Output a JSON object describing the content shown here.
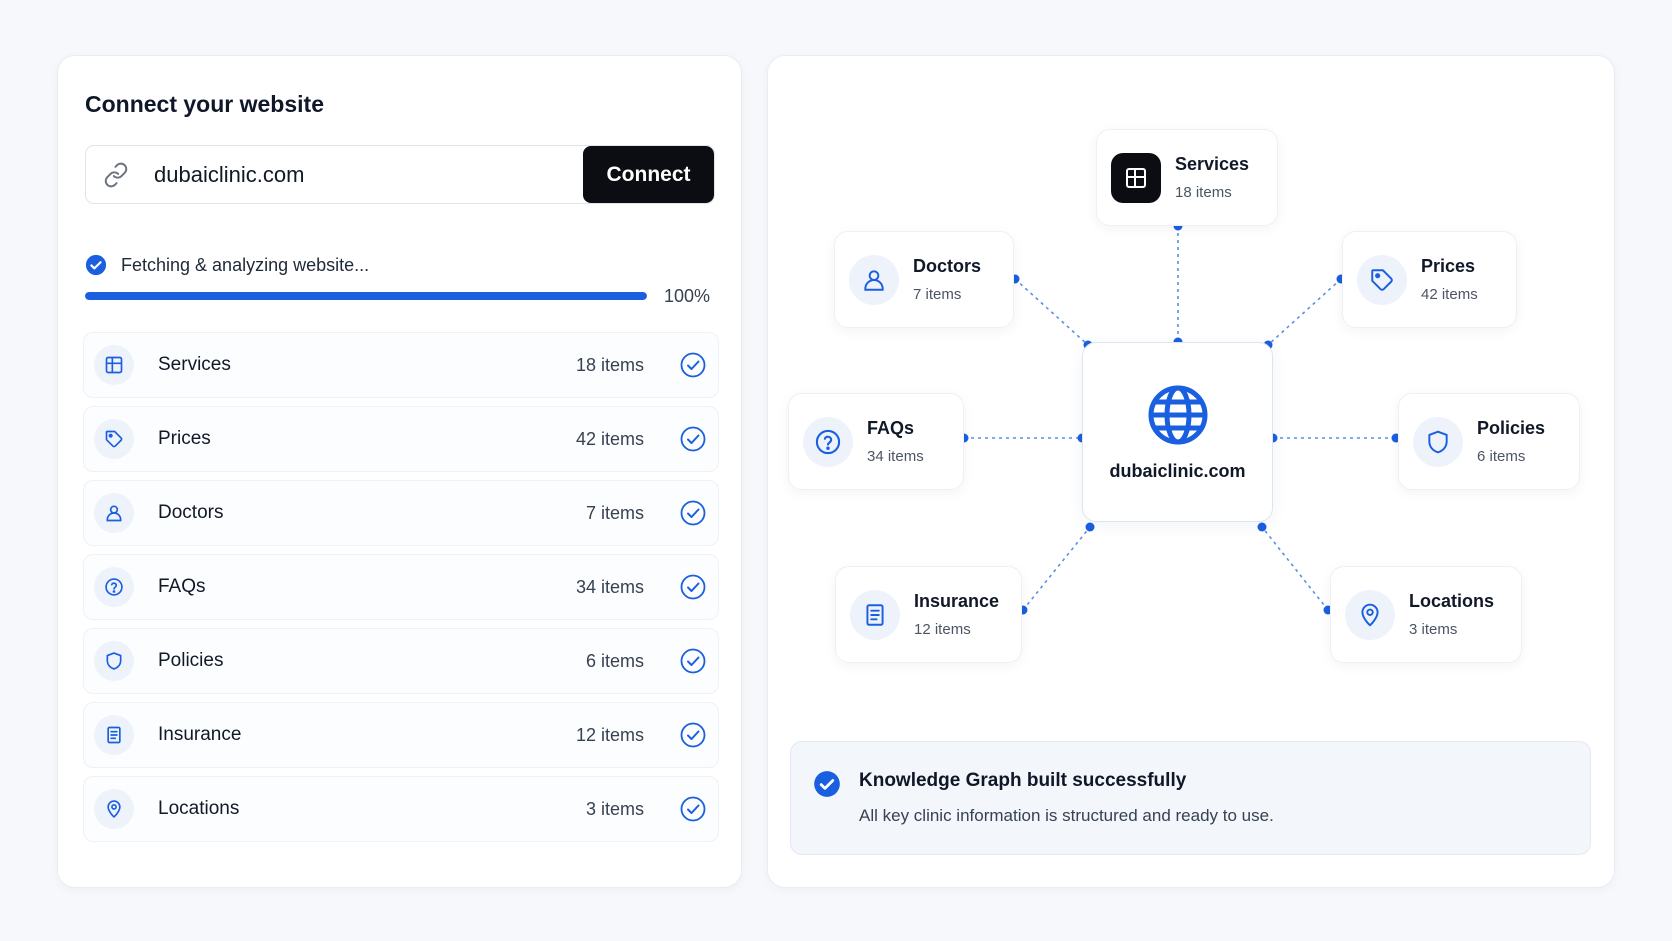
{
  "left_panel": {
    "title": "Connect your website",
    "url_value": "dubaiclinic.com",
    "connect_label": "Connect",
    "status_text": "Fetching & analyzing website...",
    "progress": 100,
    "progress_label": "100%",
    "items": [
      {
        "icon": "grid-icon",
        "label": "Services",
        "count": "18 items"
      },
      {
        "icon": "tag-icon",
        "label": "Prices",
        "count": "42 items"
      },
      {
        "icon": "user-icon",
        "label": "Doctors",
        "count": "7 items"
      },
      {
        "icon": "question-icon",
        "label": "FAQs",
        "count": "34 items"
      },
      {
        "icon": "shield-icon",
        "label": "Policies",
        "count": "6 items"
      },
      {
        "icon": "document-icon",
        "label": "Insurance",
        "count": "12 items"
      },
      {
        "icon": "location-pin-icon",
        "label": "Locations",
        "count": "3 items"
      }
    ]
  },
  "graph": {
    "center_label": "dubaiclinic.com",
    "nodes": {
      "services": {
        "title": "Services",
        "sub": "18 items"
      },
      "doctors": {
        "title": "Doctors",
        "sub": "7 items"
      },
      "prices": {
        "title": "Prices",
        "sub": "42 items"
      },
      "faqs": {
        "title": "FAQs",
        "sub": "34 items"
      },
      "policies": {
        "title": "Policies",
        "sub": "6 items"
      },
      "insurance": {
        "title": "Insurance",
        "sub": "12 items"
      },
      "locations": {
        "title": "Locations",
        "sub": "3 items"
      }
    }
  },
  "success": {
    "title": "Knowledge Graph built successfully",
    "description": "All key clinic information is structured and ready to use."
  },
  "colors": {
    "accent": "#1a5fe0",
    "dark": "#0b0d12",
    "background": "#f6f8fb"
  }
}
